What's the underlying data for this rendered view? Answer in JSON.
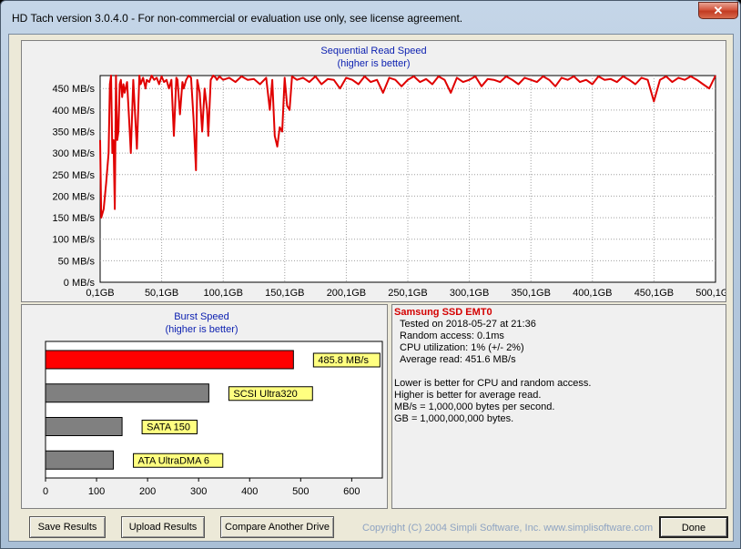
{
  "window": {
    "title": "HD Tach version 3.0.4.0  - For non-commercial or evaluation use only, see license agreement.",
    "close_glyph": "✕"
  },
  "chart_data": [
    {
      "type": "line",
      "title": "Sequential Read Speed",
      "subtitle": "(higher is better)",
      "xlabel": "",
      "ylabel": "",
      "x_unit": "GB",
      "y_unit": "MB/s",
      "xlim": [
        0.1,
        500.1
      ],
      "ylim": [
        0,
        480
      ],
      "x_ticks": [
        "0,1GB",
        "50,1GB",
        "100,1GB",
        "150,1GB",
        "200,1GB",
        "250,1GB",
        "300,1GB",
        "350,1GB",
        "400,1GB",
        "450,1GB",
        "500,1GB"
      ],
      "y_ticks": [
        "0 MB/s",
        "50 MB/s",
        "100 MB/s",
        "150 MB/s",
        "200 MB/s",
        "250 MB/s",
        "300 MB/s",
        "350 MB/s",
        "400 MB/s",
        "450 MB/s"
      ],
      "grid": true,
      "line_color": "#e00000",
      "series": [
        {
          "x": [
            0.1,
            1,
            3,
            5,
            7,
            8,
            9,
            10,
            11,
            12,
            13,
            14,
            15,
            16,
            17,
            18,
            19,
            20,
            22,
            24,
            25,
            27,
            30,
            32,
            33,
            35,
            37,
            38,
            40,
            42,
            44,
            46,
            48,
            50,
            52,
            54,
            56,
            58,
            60,
            62,
            63,
            65,
            67,
            68,
            70,
            72,
            74,
            76,
            78,
            79,
            81,
            83,
            85,
            87,
            88,
            90,
            92,
            94,
            95,
            97,
            100,
            105,
            110,
            115,
            120,
            125,
            130,
            135,
            138,
            140,
            142,
            144,
            146,
            148,
            150,
            152,
            154,
            156,
            160,
            165,
            170,
            175,
            180,
            185,
            190,
            195,
            200,
            205,
            210,
            215,
            220,
            225,
            230,
            235,
            240,
            245,
            250,
            255,
            260,
            265,
            270,
            275,
            280,
            285,
            290,
            295,
            300,
            305,
            310,
            315,
            320,
            325,
            330,
            335,
            340,
            345,
            350,
            355,
            360,
            365,
            370,
            375,
            380,
            385,
            390,
            395,
            400,
            405,
            410,
            415,
            420,
            425,
            430,
            435,
            440,
            445,
            450,
            455,
            460,
            465,
            470,
            475,
            480,
            485,
            490,
            495,
            500.1
          ],
          "y": [
            330,
            150,
            170,
            230,
            300,
            460,
            480,
            300,
            330,
            170,
            480,
            330,
            350,
            460,
            470,
            430,
            460,
            440,
            465,
            360,
            300,
            470,
            310,
            480,
            460,
            475,
            450,
            470,
            465,
            480,
            470,
            475,
            460,
            478,
            465,
            470,
            450,
            470,
            340,
            475,
            470,
            390,
            465,
            450,
            470,
            480,
            475,
            380,
            260,
            470,
            440,
            350,
            450,
            400,
            340,
            470,
            480,
            475,
            470,
            478,
            470,
            475,
            465,
            478,
            470,
            472,
            460,
            475,
            400,
            470,
            340,
            315,
            360,
            350,
            475,
            410,
            400,
            478,
            470,
            475,
            465,
            478,
            460,
            472,
            470,
            450,
            475,
            470,
            460,
            478,
            465,
            470,
            440,
            475,
            470,
            455,
            470,
            478,
            465,
            472,
            460,
            478,
            470,
            440,
            475,
            465,
            470,
            478,
            455,
            472,
            470,
            465,
            478,
            470,
            460,
            475,
            470,
            465,
            478,
            470,
            455,
            475,
            470,
            478,
            465,
            470,
            460,
            478,
            470,
            472,
            465,
            478,
            470,
            460,
            475,
            470,
            420,
            470,
            478,
            465,
            475,
            470,
            478,
            470,
            460,
            450,
            480
          ]
        }
      ]
    },
    {
      "type": "bar",
      "orientation": "horizontal",
      "title": "Burst Speed",
      "subtitle": "(higher is better)",
      "xlim": [
        0,
        660
      ],
      "x_ticks": [
        "0",
        "100",
        "200",
        "300",
        "400",
        "500",
        "600"
      ],
      "categories": [
        "Samsung SSD EMT0",
        "SCSI Ultra320",
        "SATA 150",
        "ATA UltraDMA 6"
      ],
      "values": [
        485.8,
        320,
        150,
        133
      ],
      "bar_labels": [
        "485.8 MB/s",
        "SCSI Ultra320",
        "SATA 150",
        "ATA UltraDMA 6"
      ],
      "colors": [
        "#ff0000",
        "#808080",
        "#808080",
        "#808080"
      ],
      "label_bg": "#ffff80"
    }
  ],
  "info": {
    "drive_name": "Samsung SSD EMT0",
    "tested_on": "Tested on 2018-05-27 at 21:36",
    "random_access": "Random access: 0.1ms",
    "cpu": "CPU utilization: 1% (+/- 2%)",
    "average_read": "Average read: 451.6 MB/s",
    "note1": "Lower is better for CPU and random access.",
    "note2": "Higher is better for average read.",
    "note3": "MB/s = 1,000,000 bytes per second.",
    "note4": "GB = 1,000,000,000 bytes."
  },
  "buttons": {
    "save": "Save Results",
    "upload": "Upload Results",
    "compare": "Compare Another Drive",
    "done": "Done"
  },
  "copyright": "Copyright (C) 2004 Simpli Software, Inc. www.simplisoftware.com"
}
